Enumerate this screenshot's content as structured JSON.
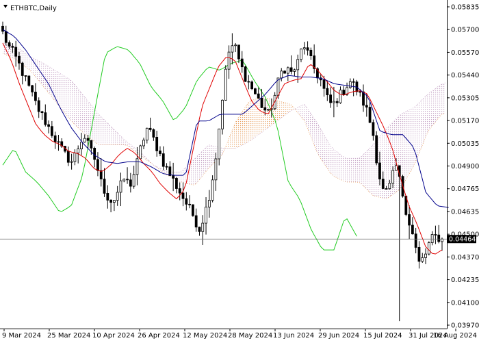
{
  "header": {
    "symbol_label": "ETHBTC,Daily",
    "triangle_icon": "triangle-down-icon"
  },
  "current_price": "0.04464",
  "colors": {
    "background": "#ffffff",
    "candle": "#000000",
    "tenkan": "#e00000",
    "kijun": "#00008b",
    "chikou": "#22cc22",
    "kumo_bull": "#e8a060",
    "kumo_bear": "#c8a8c8",
    "price_line": "#606060",
    "price_box": "#000000"
  },
  "chart_data": {
    "type": "candlestick",
    "indicator": "ichimoku",
    "x_ticks": [
      "9 Mar 2024",
      "25 Mar 2024",
      "10 Apr 2024",
      "26 Apr 2024",
      "12 May 2024",
      "28 May 2024",
      "13 Jun 2024",
      "29 Jun 2024",
      "15 Jul 2024",
      "31 Jul 2024",
      "16 Aug 2024"
    ],
    "y_ticks": [
      "0.05835",
      "0.05700",
      "0.05570",
      "0.05440",
      "0.05305",
      "0.05170",
      "0.05035",
      "0.04900",
      "0.04765",
      "0.04635",
      "0.04500",
      "0.04370",
      "0.04235",
      "0.04100",
      "0.03970"
    ],
    "ylim": [
      0.0394,
      0.0587
    ],
    "close_path": [
      0.0568,
      0.056,
      0.0555,
      0.0548,
      0.054,
      0.0532,
      0.0524,
      0.0518,
      0.0512,
      0.0506,
      0.05,
      0.0495,
      0.0492,
      0.05,
      0.0508,
      0.05,
      0.0493,
      0.048,
      0.0472,
      0.0468,
      0.0475,
      0.0482,
      0.0478,
      0.0488,
      0.0502,
      0.0512,
      0.0506,
      0.0498,
      0.049,
      0.0484,
      0.0478,
      0.0472,
      0.0466,
      0.046,
      0.0452,
      0.0462,
      0.0476,
      0.0498,
      0.053,
      0.0556,
      0.0562,
      0.055,
      0.0542,
      0.0536,
      0.053,
      0.0524,
      0.052,
      0.053,
      0.0544,
      0.0548,
      0.0544,
      0.055,
      0.0562,
      0.0554,
      0.0546,
      0.054,
      0.053,
      0.0525,
      0.053,
      0.0534,
      0.054,
      0.0536,
      0.053,
      0.0522,
      0.051,
      0.0486,
      0.0472,
      0.0478,
      0.049,
      0.0476,
      0.046,
      0.0448,
      0.0432,
      0.0436,
      0.0446,
      0.0448,
      0.0446
    ],
    "tenkan": [
      0.0562,
      0.0552,
      0.0538,
      0.0526,
      0.0514,
      0.0508,
      0.0504,
      0.0502,
      0.0498,
      0.0497,
      0.0494,
      0.0488,
      0.0486,
      0.049,
      0.0496,
      0.05,
      0.0497,
      0.0491,
      0.0486,
      0.0479,
      0.0474,
      0.047,
      0.0476,
      0.05,
      0.0524,
      0.0536,
      0.0548,
      0.0554,
      0.0552,
      0.054,
      0.0528,
      0.0522,
      0.052,
      0.0529,
      0.0538,
      0.054,
      0.0541,
      0.055,
      0.0546,
      0.054,
      0.0534,
      0.0531,
      0.0533,
      0.0534,
      0.0532,
      0.0522,
      0.0512,
      0.05,
      0.0482,
      0.0466,
      0.0455,
      0.0442,
      0.0437,
      0.044
    ],
    "kijun": [
      0.057,
      0.0566,
      0.0558,
      0.0548,
      0.0538,
      0.0524,
      0.0512,
      0.0503,
      0.0496,
      0.0492,
      0.0491,
      0.0492,
      0.0492,
      0.0489,
      0.0485,
      0.0484,
      0.0484,
      0.0516,
      0.0516,
      0.052,
      0.052,
      0.052,
      0.0526,
      0.0532,
      0.054,
      0.0543,
      0.0542,
      0.0542,
      0.0541,
      0.0538,
      0.0537,
      0.0536,
      0.053,
      0.051,
      0.0508,
      0.0508,
      0.05,
      0.0474,
      0.0466,
      0.0465
    ],
    "chikou": [
      0.049,
      0.05,
      0.0486,
      0.048,
      0.0472,
      0.0462,
      0.0466,
      0.0484,
      0.052,
      0.0556,
      0.056,
      0.0558,
      0.055,
      0.0536,
      0.0528,
      0.0516,
      0.0524,
      0.054,
      0.0548,
      0.0546,
      0.055,
      0.0552,
      0.054,
      0.053,
      0.0514,
      0.048,
      0.047,
      0.0452,
      0.044,
      0.044,
      0.046,
      0.0448
    ],
    "senkou_a": [
      0.0556,
      0.0552,
      0.0546,
      0.0536,
      0.0526,
      0.0516,
      0.0508,
      0.0502,
      0.0502,
      0.0502,
      0.0496,
      0.049,
      0.0484,
      0.048,
      0.0478,
      0.0488,
      0.0496,
      0.0516,
      0.0528,
      0.053,
      0.0528,
      0.0526,
      0.0516,
      0.0496,
      0.0484,
      0.048,
      0.048,
      0.0472,
      0.047,
      0.0476,
      0.049,
      0.051,
      0.052,
      0.0522,
      0.053,
      0.0532,
      0.0534,
      0.0534,
      0.0532
    ],
    "senkou_b": [
      0.0562,
      0.056,
      0.0554,
      0.055,
      0.0545,
      0.054,
      0.053,
      0.052,
      0.0512,
      0.0504,
      0.0498,
      0.049,
      0.0486,
      0.0486,
      0.0494,
      0.0502,
      0.05,
      0.05,
      0.0504,
      0.051,
      0.0516,
      0.0522,
      0.0526,
      0.0514,
      0.05,
      0.0494,
      0.0494,
      0.0502,
      0.0512,
      0.052,
      0.0524,
      0.0532,
      0.0538,
      0.054,
      0.0538,
      0.0536,
      0.0534,
      0.0532,
      0.053
    ],
    "grid": false
  }
}
